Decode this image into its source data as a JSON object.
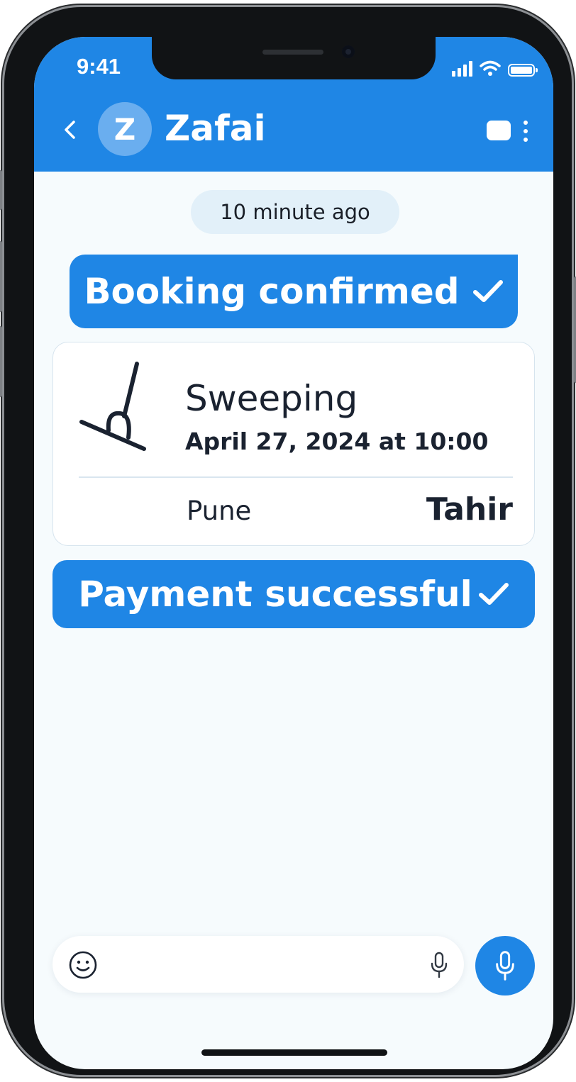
{
  "status_bar": {
    "time": "9:41",
    "icons": [
      "signal-icon",
      "wifi-icon",
      "battery-icon"
    ]
  },
  "header": {
    "back_icon": "chevron-left-icon",
    "avatar_initial": "Z",
    "title": "Zafai",
    "actions": [
      "video-icon",
      "more-vertical-icon"
    ]
  },
  "chat": {
    "timestamp": "10 minute ago",
    "booking_message": "Booking confirmed",
    "booking_check_icon": "check-icon",
    "booking_card": {
      "icon": "broom-icon",
      "service": "Sweeping",
      "datetime": "April 27, 2024 at 10:00",
      "location": "Pune",
      "provider": "Tahir"
    },
    "payment_message": "Payment successful",
    "payment_check_icon": "check-icon"
  },
  "composer": {
    "emoji_icon": "smiley-icon",
    "input_value": "",
    "input_placeholder": "",
    "inline_mic_icon": "microphone-icon",
    "voice_button_icon": "microphone-icon"
  },
  "colors": {
    "accent": "#1f86e5",
    "background": "#f6fbfd",
    "text": "#1a2230",
    "timestamp_pill": "#e2f0f9"
  }
}
